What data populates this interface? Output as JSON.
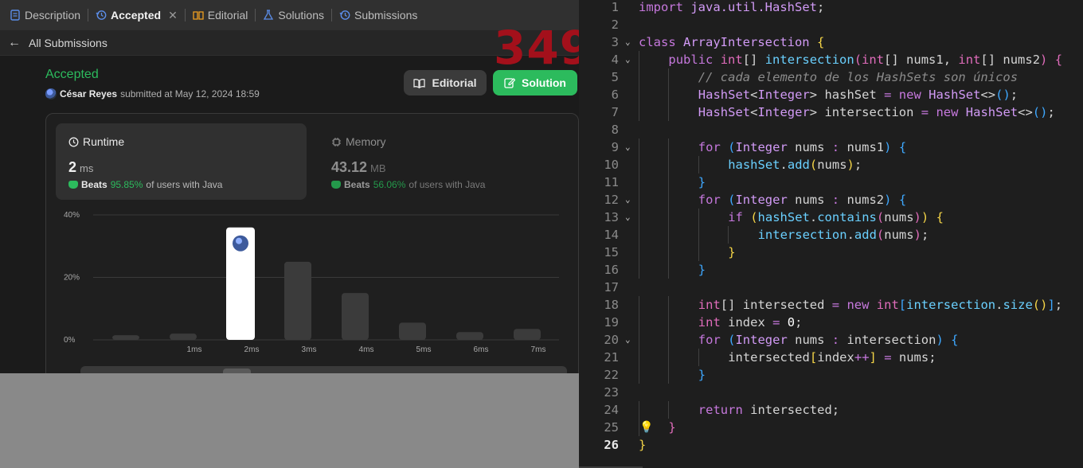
{
  "tabs": [
    {
      "label": "Description",
      "icon": "document-icon",
      "active": false
    },
    {
      "label": "Accepted",
      "icon": "history-icon",
      "active": true
    },
    {
      "label": "Editorial",
      "icon": "book-icon",
      "active": false
    },
    {
      "label": "Solutions",
      "icon": "flask-icon",
      "active": false
    },
    {
      "label": "Submissions",
      "icon": "history-icon",
      "active": false
    }
  ],
  "back_link": "All Submissions",
  "overlay_counter": "349",
  "submission": {
    "status": "Accepted",
    "user": "César Reyes",
    "submitted_text": "submitted at May 12, 2024 18:59",
    "editorial_button": "Editorial",
    "solution_button": "Solution"
  },
  "runtime": {
    "title": "Runtime",
    "value": "2",
    "unit": "ms",
    "beats_label": "Beats",
    "beats_pct": "95.85%",
    "beats_suffix": "of users with Java"
  },
  "memory": {
    "title": "Memory",
    "value": "43.12",
    "unit": "MB",
    "beats_label": "Beats",
    "beats_pct": "56.06%",
    "beats_suffix": "of users with Java"
  },
  "colors": {
    "accent_green": "#2cbb5d",
    "bar": "#3b3b3b",
    "selected_bar": "#ffffff",
    "counter_red": "#a3101b"
  },
  "chart_data": {
    "type": "bar",
    "y_ticks": [
      "40%",
      "20%",
      "0%"
    ],
    "ylim": [
      0,
      40
    ],
    "categories": [
      "",
      "1ms",
      "2ms",
      "3ms",
      "4ms",
      "5ms",
      "6ms",
      "7ms"
    ],
    "values": [
      1.5,
      2,
      36,
      25,
      15,
      5.5,
      2.5,
      3.5
    ],
    "selected_index": 2
  },
  "editor": {
    "current_line": 26,
    "lines": [
      {
        "n": "1",
        "fold": false,
        "indent": 0,
        "tokens": [
          [
            "kw",
            "import "
          ],
          [
            "cl",
            "java.util."
          ],
          [
            "cl",
            "HashSet"
          ],
          [
            "v",
            ";"
          ]
        ]
      },
      {
        "n": "2",
        "fold": false,
        "indent": 0,
        "tokens": []
      },
      {
        "n": "3",
        "fold": true,
        "indent": 0,
        "tokens": [
          [
            "kw",
            "class "
          ],
          [
            "cl",
            "ArrayIntersection "
          ],
          [
            "y",
            "{"
          ]
        ]
      },
      {
        "n": "4",
        "fold": true,
        "indent": 1,
        "tokens": [
          [
            "kw",
            "public "
          ],
          [
            "ty",
            "int"
          ],
          [
            "v",
            "[] "
          ],
          [
            "fn",
            "intersection"
          ],
          [
            "p",
            "("
          ],
          [
            "ty",
            "int"
          ],
          [
            "v",
            "[] nums1, "
          ],
          [
            "ty",
            "int"
          ],
          [
            "v",
            "[] nums2"
          ],
          [
            "p",
            ")"
          ],
          [
            "v",
            " "
          ],
          [
            "p",
            "{"
          ]
        ]
      },
      {
        "n": "5",
        "fold": false,
        "indent": 2,
        "tokens": [
          [
            "cm",
            "// cada elemento de los HashSets son únicos"
          ]
        ]
      },
      {
        "n": "6",
        "fold": false,
        "indent": 2,
        "tokens": [
          [
            "cl",
            "HashSet"
          ],
          [
            "v",
            "<"
          ],
          [
            "cl",
            "Integer"
          ],
          [
            "v",
            "> hashSet "
          ],
          [
            "m",
            "= "
          ],
          [
            "kw",
            "new "
          ],
          [
            "cl",
            "HashSet"
          ],
          [
            "v",
            "<>"
          ],
          [
            "b",
            "()"
          ],
          [
            "v",
            ";"
          ]
        ]
      },
      {
        "n": "7",
        "fold": false,
        "indent": 2,
        "tokens": [
          [
            "cl",
            "HashSet"
          ],
          [
            "v",
            "<"
          ],
          [
            "cl",
            "Integer"
          ],
          [
            "v",
            "> intersection "
          ],
          [
            "m",
            "= "
          ],
          [
            "kw",
            "new "
          ],
          [
            "cl",
            "HashSet"
          ],
          [
            "v",
            "<>"
          ],
          [
            "b",
            "()"
          ],
          [
            "v",
            ";"
          ]
        ]
      },
      {
        "n": "8",
        "fold": false,
        "indent": 0,
        "tokens": []
      },
      {
        "n": "9",
        "fold": true,
        "indent": 2,
        "tokens": [
          [
            "kw",
            "for "
          ],
          [
            "b",
            "("
          ],
          [
            "cl",
            "Integer "
          ],
          [
            "v",
            "nums "
          ],
          [
            "m",
            ": "
          ],
          [
            "v",
            "nums1"
          ],
          [
            "b",
            ")"
          ],
          [
            "v",
            " "
          ],
          [
            "b",
            "{"
          ]
        ]
      },
      {
        "n": "10",
        "fold": false,
        "indent": 3,
        "tokens": [
          [
            "fn",
            "hashSet"
          ],
          [
            "v",
            "."
          ],
          [
            "fn",
            "add"
          ],
          [
            "y",
            "("
          ],
          [
            "v",
            "nums"
          ],
          [
            "y",
            ")"
          ],
          [
            "v",
            ";"
          ]
        ]
      },
      {
        "n": "11",
        "fold": false,
        "indent": 2,
        "tokens": [
          [
            "b",
            "}"
          ]
        ]
      },
      {
        "n": "12",
        "fold": true,
        "indent": 2,
        "tokens": [
          [
            "kw",
            "for "
          ],
          [
            "b",
            "("
          ],
          [
            "cl",
            "Integer "
          ],
          [
            "v",
            "nums "
          ],
          [
            "m",
            ": "
          ],
          [
            "v",
            "nums2"
          ],
          [
            "b",
            ")"
          ],
          [
            "v",
            " "
          ],
          [
            "b",
            "{"
          ]
        ]
      },
      {
        "n": "13",
        "fold": true,
        "indent": 3,
        "tokens": [
          [
            "kw",
            "if "
          ],
          [
            "y",
            "("
          ],
          [
            "fn",
            "hashSet"
          ],
          [
            "v",
            "."
          ],
          [
            "fn",
            "contains"
          ],
          [
            "p",
            "("
          ],
          [
            "v",
            "nums"
          ],
          [
            "p",
            ")"
          ],
          [
            "y",
            ")"
          ],
          [
            "v",
            " "
          ],
          [
            "y",
            "{"
          ]
        ]
      },
      {
        "n": "14",
        "fold": false,
        "indent": 4,
        "tokens": [
          [
            "fn",
            "intersection"
          ],
          [
            "v",
            "."
          ],
          [
            "fn",
            "add"
          ],
          [
            "p",
            "("
          ],
          [
            "v",
            "nums"
          ],
          [
            "p",
            ")"
          ],
          [
            "v",
            ";"
          ]
        ]
      },
      {
        "n": "15",
        "fold": false,
        "indent": 3,
        "tokens": [
          [
            "y",
            "}"
          ]
        ]
      },
      {
        "n": "16",
        "fold": false,
        "indent": 2,
        "tokens": [
          [
            "b",
            "}"
          ]
        ]
      },
      {
        "n": "17",
        "fold": false,
        "indent": 0,
        "tokens": []
      },
      {
        "n": "18",
        "fold": false,
        "indent": 2,
        "tokens": [
          [
            "ty",
            "int"
          ],
          [
            "v",
            "[] intersected "
          ],
          [
            "m",
            "= "
          ],
          [
            "kw",
            "new "
          ],
          [
            "ty",
            "int"
          ],
          [
            "b",
            "["
          ],
          [
            "fn",
            "intersection"
          ],
          [
            "v",
            "."
          ],
          [
            "fn",
            "size"
          ],
          [
            "y",
            "()"
          ],
          [
            "b",
            "]"
          ],
          [
            "v",
            ";"
          ]
        ]
      },
      {
        "n": "19",
        "fold": false,
        "indent": 2,
        "tokens": [
          [
            "ty",
            "int "
          ],
          [
            "v",
            "index "
          ],
          [
            "m",
            "= "
          ],
          [
            "num",
            "0"
          ],
          [
            "v",
            ";"
          ]
        ]
      },
      {
        "n": "20",
        "fold": true,
        "indent": 2,
        "tokens": [
          [
            "kw",
            "for "
          ],
          [
            "b",
            "("
          ],
          [
            "cl",
            "Integer "
          ],
          [
            "v",
            "nums "
          ],
          [
            "m",
            ": "
          ],
          [
            "v",
            "intersection"
          ],
          [
            "b",
            ")"
          ],
          [
            "v",
            " "
          ],
          [
            "b",
            "{"
          ]
        ]
      },
      {
        "n": "21",
        "fold": false,
        "indent": 3,
        "tokens": [
          [
            "v",
            "intersected"
          ],
          [
            "y",
            "["
          ],
          [
            "v",
            "index"
          ],
          [
            "m",
            "++"
          ],
          [
            "y",
            "]"
          ],
          [
            "v",
            " "
          ],
          [
            "m",
            "= "
          ],
          [
            "v",
            "nums;"
          ]
        ]
      },
      {
        "n": "22",
        "fold": false,
        "indent": 2,
        "tokens": [
          [
            "b",
            "}"
          ]
        ]
      },
      {
        "n": "23",
        "fold": false,
        "indent": 0,
        "tokens": []
      },
      {
        "n": "24",
        "fold": false,
        "indent": 2,
        "tokens": [
          [
            "kw",
            "return "
          ],
          [
            "v",
            "intersected;"
          ]
        ]
      },
      {
        "n": "25",
        "fold": false,
        "indent": 1,
        "bulb": true,
        "tokens": [
          [
            "p",
            "}"
          ]
        ]
      },
      {
        "n": "26",
        "fold": false,
        "indent": 0,
        "tokens": [
          [
            "y",
            "}"
          ]
        ]
      }
    ]
  }
}
